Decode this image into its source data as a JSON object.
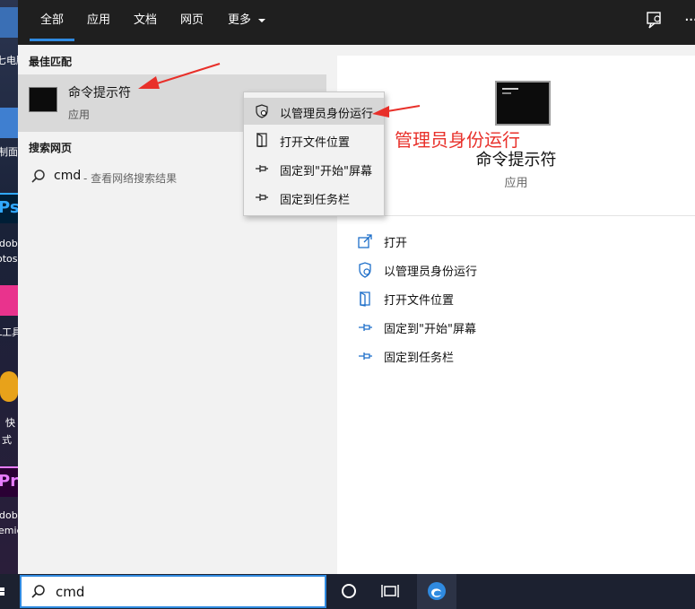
{
  "tabs": [
    {
      "label": "全部"
    },
    {
      "label": "应用"
    },
    {
      "label": "文档"
    },
    {
      "label": "网页"
    },
    {
      "label": "更多"
    }
  ],
  "best_match": {
    "section_title": "最佳匹配",
    "name": "命令提示符",
    "type": "应用"
  },
  "web_search": {
    "section_title": "搜索网页",
    "query": "cmd",
    "hint": " - 查看网络搜索结果"
  },
  "context_menu": [
    {
      "label": "以管理员身份运行",
      "icon": "shield-icon"
    },
    {
      "label": "打开文件位置",
      "icon": "folder-open-icon"
    },
    {
      "label": "固定到\"开始\"屏幕",
      "icon": "pin-icon"
    },
    {
      "label": "固定到任务栏",
      "icon": "pin-icon"
    }
  ],
  "preview": {
    "name": "命令提示符",
    "type": "应用",
    "actions": [
      {
        "label": "打开",
        "icon": "open-icon"
      },
      {
        "label": "以管理员身份运行",
        "icon": "shield-icon"
      },
      {
        "label": "打开文件位置",
        "icon": "folder-open-icon"
      },
      {
        "label": "固定到\"开始\"屏幕",
        "icon": "pin-icon"
      },
      {
        "label": "固定到任务栏",
        "icon": "pin-icon"
      }
    ]
  },
  "annotation": {
    "text": "管理员身份运行",
    "color": "#e8302a"
  },
  "taskbar": {
    "search_value": "cmd"
  },
  "desktop_labels": [
    "七电脑",
    "制面",
    "dob",
    "otos",
    "L工具",
    "快",
    "式",
    "dob",
    "emie"
  ],
  "colors": {
    "accent": "#2f8ae0",
    "highlight": "#d9d9d9",
    "annotation": "#e8302a"
  }
}
